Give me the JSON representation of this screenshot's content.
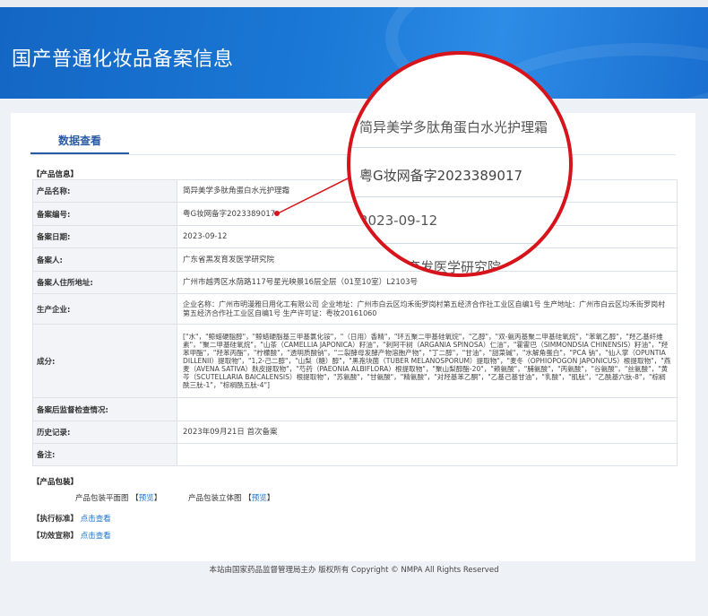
{
  "header": {
    "title": "国产普通化妆品备案信息"
  },
  "tabs": [
    {
      "label": "数据查看"
    }
  ],
  "sections": {
    "product_info": "【产品信息】",
    "packaging": "【产品包装】"
  },
  "product": {
    "name_label": "产品名称:",
    "name": "简异美学多肽角蛋白水光护理霜",
    "record_no_label": "备案编号:",
    "record_no": "粤G妆网备字2023389017",
    "record_date_label": "备案日期:",
    "record_date": "2023-09-12",
    "registrant_label": "备案人:",
    "registrant": "广东省黑发育发医学研究院",
    "registrant_address_label": "备案人住所地址:",
    "registrant_address": "广州市越秀区水荫路117号星光映景16层全层（01至10室）L2103号",
    "manufacturer_label": "生产企业:",
    "manufacturer": "企业名称：广州市明漫雅日用化工有限公司 企业地址：广州市白云区均禾街罗岗村第五经济合作社工业区自编1号 生产地址：广州市白云区均禾街罗岗村第五经济合作社工业区自编1号 生产许可证：粤妆20161060",
    "ingredients_label": "成分:",
    "ingredients": "[\"水\"，\"鲸蜡硬脂醇\"，\"鲸蜡硬脂基三甲基氯化铵\"，\"（日用）香精\"，\"环五聚二甲基硅氧烷\"，\"乙醇\"，\"双-氨丙基聚二甲基硅氧烷\"，\"苯氧乙醇\"，\"羟乙基纤维素\"，\"聚二甲基硅氧烷\"，\"山茶（CAMELLIA JAPONICA）籽油\"，\"刺阿干树（ARGANIA SPINOSA）仁油\"，\"霍霍巴（SIMMONDSIA CHINENSIS）籽油\"，\"羟苯甲酯\"，\"羟苯丙酯\"，\"柠檬酸\"，\"透明质酸钠\"，\"二裂酵母发酵产物溶胞产物\"，\"丁二醇\"，\"甘油\"，\"甜菜碱\"，\"水解角蛋白\"，\"PCA 钠\"，\"仙人掌（OPUNTIA DILLENII）提取物\"，\"1,2-己二醇\"，\"山梨（糖）醇\"，\"黑孢块菌（TUBER MELANOSPORUM）提取物\"，\"麦冬（OPHIOPOGON JAPONICUS）根提取物\"，\"燕麦（AVENA SATIVA）麸皮提取物\"，\"芍药（PAEONIA ALBIFLORA）根提取物\"，\"聚山梨醇酯-20\"，\"赖氨酸\"，\"脯氨酸\"，\"丙氨酸\"，\"谷氨酸\"，\"丝氨酸\"，\"黄芩（SCUTELLARIA BAICALENSIS）根提取物\"，\"苏氨酸\"，\"甘氨酸\"，\"精氨酸\"，\"对羟基苯乙酮\"，\"乙基己基甘油\"，\"乳酸\"，\"肌肽\"，\"乙酰基六肽-8\"，\"棕榈酰三肽-1\"，\"棕榈酰五肽-4\"]",
    "post_inspection_label": "备案后监督检查情况:",
    "post_inspection": "",
    "history_label": "历史记录:",
    "history": "2023年09月21日 首次备案",
    "remarks_label": "备注:",
    "remarks": ""
  },
  "packaging": {
    "flat_label": "产品包装平面图",
    "flat_link": "预览",
    "stereo_label": "产品包装立体图",
    "stereo_link": "预览",
    "standard_label": "【执行标准】",
    "standard_link": "点击查看",
    "efficacy_label": "【功效宣称】",
    "efficacy_link": "点击查看"
  },
  "magnifier": {
    "line1": "简异美学多肽角蛋白水光护理霜",
    "line2": "粤G妆网备字2023389017",
    "line3": "2023-09-12",
    "line4": "广东省黑发育发医学研究院"
  },
  "footer": {
    "text": "本站由国家药品监督管理局主办 版权所有 Copyright © NMPA All Rights Reserved"
  },
  "colors": {
    "banner": "#1a78d6",
    "accent": "#2a5ba7",
    "link": "#1a73d0",
    "highlight": "#d7141b"
  }
}
